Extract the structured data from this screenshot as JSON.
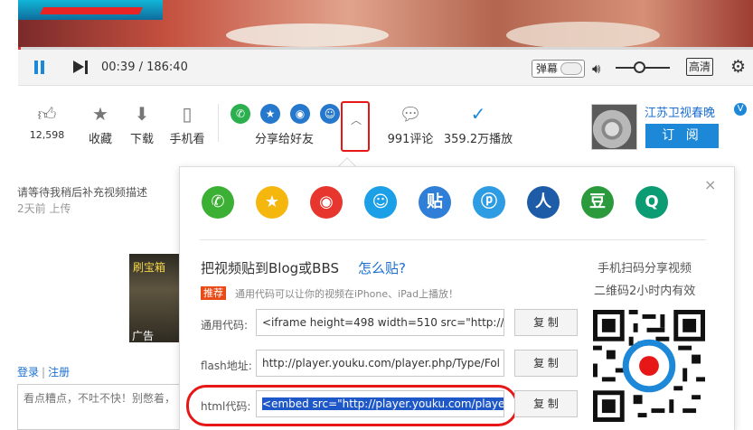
{
  "player": {
    "time": "00:39 / 186:40",
    "progress_fraction": 0.0035,
    "danmu_label": "弹幕",
    "quality_label": "高清",
    "volume_fraction": 0.45
  },
  "actions": {
    "like_count": "12,598",
    "favorite_label": "收藏",
    "download_label": "下载",
    "mobile_label": "手机看",
    "share_label": "分享给好友",
    "comments_label": "991评论",
    "plays_label": "359.2万播放"
  },
  "channel": {
    "name": "江苏卫视春晚",
    "badge": "V",
    "subscribe_label": "订 阅"
  },
  "description": {
    "text": "请等待我稍后补充视频描述",
    "posted": "2天前 上传"
  },
  "ad": {
    "top_text": "刷宝箱",
    "bottom_text": "广告"
  },
  "login": {
    "login_label": "登录",
    "separator": "|",
    "register_label": "注册"
  },
  "comment": {
    "placeholder": "看点糟点，不吐不快！别憋着，"
  },
  "share_popup": {
    "close_symbol": "×",
    "embed_title": "把视频贴到Blog或BBS",
    "how_label": "怎么贴?",
    "recommend_badge": "推荐",
    "recommend_text": "通用代码可以让你的视频在iPhone、iPad上播放！",
    "rows": [
      {
        "label": "通用代码:",
        "value": "<iframe height=498 width=510 src=\"http://p",
        "copy": "复 制"
      },
      {
        "label": "flash地址:",
        "value": "http://player.youku.com/player.php/Type/Fol",
        "copy": "复 制"
      },
      {
        "label": "html代码:",
        "value": "<embed src=\"http://player.youku.com/player",
        "copy": "复 制"
      }
    ],
    "qr_title": "手机扫码分享视频",
    "qr_sub": "二维码2小时内有效",
    "big_icons": [
      {
        "name": "wechat",
        "glyph": "✆",
        "color": "#3cb034"
      },
      {
        "name": "qzone",
        "glyph": "★",
        "color": "#f5b70d"
      },
      {
        "name": "weibo",
        "glyph": "◉",
        "color": "#e6362d"
      },
      {
        "name": "qq",
        "glyph": "☺",
        "color": "#1b9fe6"
      },
      {
        "name": "tieba",
        "glyph": "贴",
        "color": "#2f7ed8"
      },
      {
        "name": "youku-p",
        "glyph": "ⓟ",
        "color": "#2d9ce3"
      },
      {
        "name": "renren",
        "glyph": "人",
        "color": "#1f5ca8"
      },
      {
        "name": "douban",
        "glyph": "豆",
        "color": "#2a9a3c"
      },
      {
        "name": "other",
        "glyph": "Q",
        "color": "#0c9c74"
      }
    ],
    "small_icons": [
      {
        "name": "wechat",
        "glyph": "✆",
        "color": "#2cb04f"
      },
      {
        "name": "qzone",
        "glyph": "★",
        "color": "#2678cc"
      },
      {
        "name": "weibo",
        "glyph": "◉",
        "color": "#2678cc"
      },
      {
        "name": "qq",
        "glyph": "☺",
        "color": "#2678cc"
      }
    ]
  },
  "colors": {
    "accent": "#1e88d8",
    "highlight_red": "#e81717",
    "progress_red": "#e03131"
  }
}
